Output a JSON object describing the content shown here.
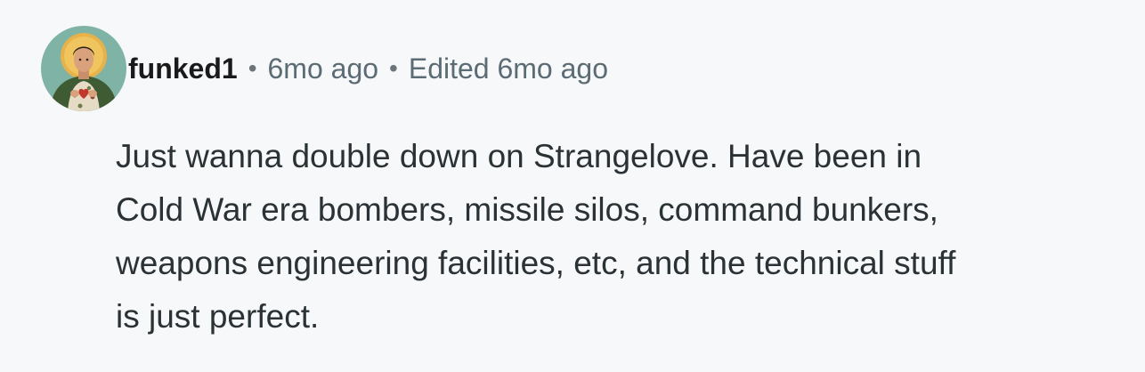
{
  "comment": {
    "author": "funked1",
    "separator": "•",
    "time": "6mo ago",
    "edited": "Edited 6mo ago",
    "body": "Just wanna double down on Strangelove. Have been in\nCold War era bombers, missile silos, command bunkers,\nweapons engineering facilities, etc, and the technical stuff\nis just perfect."
  },
  "avatar": {
    "icon": "user-avatar-icon",
    "colors": {
      "background": "#7fb3a6",
      "halo": "#e8b24a",
      "robe": "#3e5b34",
      "skin": "#d9a27c",
      "heart": "#c0392b"
    }
  }
}
